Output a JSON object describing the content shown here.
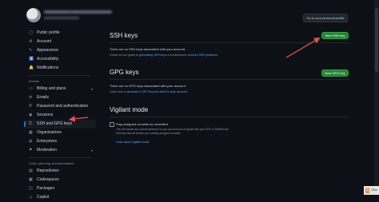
{
  "header": {
    "profile_button": "Go to your personal profile"
  },
  "sidebar": {
    "group1": [
      {
        "label": "Public profile",
        "icon": "person-icon"
      },
      {
        "label": "Account",
        "icon": "gear-icon"
      },
      {
        "label": "Appearance",
        "icon": "paintbrush-icon"
      },
      {
        "label": "Accessibility",
        "icon": "accessibility-icon"
      },
      {
        "label": "Notifications",
        "icon": "bell-icon"
      }
    ],
    "access_heading": "Access",
    "group2": [
      {
        "label": "Billing and plans",
        "icon": "credit-card-icon",
        "chevron": true
      },
      {
        "label": "Emails",
        "icon": "mail-icon"
      },
      {
        "label": "Password and authentication",
        "icon": "shield-icon"
      },
      {
        "label": "Sessions",
        "icon": "broadcast-icon"
      },
      {
        "label": "SSH and GPG keys",
        "icon": "key-icon",
        "active": true
      },
      {
        "label": "Organizations",
        "icon": "organization-icon"
      },
      {
        "label": "Enterprises",
        "icon": "globe-icon"
      },
      {
        "label": "Moderation",
        "icon": "report-icon",
        "chevron": true
      }
    ],
    "code_heading": "Code, planning, and automation",
    "group3": [
      {
        "label": "Repositories",
        "icon": "repo-icon"
      },
      {
        "label": "Codespaces",
        "icon": "codespaces-icon"
      },
      {
        "label": "Packages",
        "icon": "package-icon"
      },
      {
        "label": "Copilot",
        "icon": "copilot-icon"
      }
    ]
  },
  "ssh": {
    "title": "SSH keys",
    "new_button": "New SSH key",
    "empty_text": "There are no SSH keys associated with your account.",
    "guide_prefix": "Check out our guide to",
    "guide_link": "generating SSH keys",
    "guide_mid": "or troubleshoot",
    "guide_link2": "common SSH problems",
    "guide_end": "."
  },
  "gpg": {
    "title": "GPG keys",
    "new_button": "New GPG key",
    "empty_text": "There are no GPG keys associated with your account.",
    "learn_prefix": "Learn how to",
    "learn_link": "generate a GPG key and add it to your account",
    "learn_end": "."
  },
  "vigilant": {
    "title": "Vigilant mode",
    "checkbox_label": "Flag unsigned commits as unverified",
    "desc1": "This will include any commit attributed to your account but not signed with your GPG or S/MIME key.",
    "desc2": "Note that this will include your existing unsigned commits.",
    "learn_link": "Learn about vigilant mode."
  },
  "taskbar": {
    "label": "CBui"
  },
  "colors": {
    "background": "#0d1117",
    "accent_green": "#238636",
    "annotation_red": "#e5534b",
    "link_blue": "#58a6ff"
  }
}
